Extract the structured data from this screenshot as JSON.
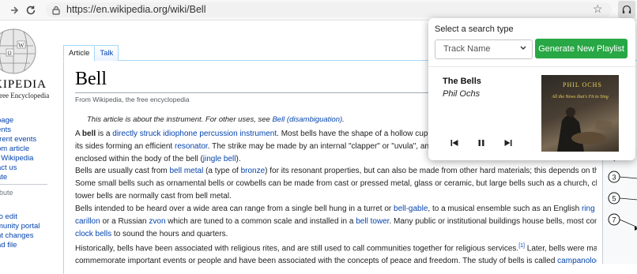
{
  "browser": {
    "url": "https://en.wikipedia.org/wiki/Bell"
  },
  "wiki": {
    "wordmark": "IKIPEDIA",
    "tagline": "Free Encyclopedia",
    "nav": [
      "page",
      "ents",
      "rrent events",
      "om article",
      "t Wikipedia",
      "act us",
      "ate"
    ],
    "nav_heading": "ibute",
    "nav2": [
      "to edit",
      "munity portal",
      "nt changes",
      "ad file"
    ],
    "tabs": {
      "article": "Article",
      "talk": "Talk"
    },
    "title": "Bell",
    "subtitle": "From Wikipedia, the free encyclopedia",
    "hatnote": {
      "text": "This article is about the instrument. For other uses, see ",
      "link": "Bell (disambiguation)",
      "end": "."
    },
    "p1": {
      "l1a": "A ",
      "l1b": "bell",
      "l1c": " is a ",
      "l1d": "directly struck idiophone percussion instrument",
      "l1e": ". Most bells have the shape of a hollow cup that when",
      "l2a": "its sides forming an efficient ",
      "l2b": "resonator",
      "l2c": ". The strike may be made by an internal \"clapper\" or \"uvula\", an external h",
      "l3a": "enclosed within the body of the bell (",
      "l3b": "jingle bell",
      "l3c": ")."
    },
    "p2": {
      "l1a": "Bells are usually cast from ",
      "l1b": "bell metal",
      "l1c": " (a type of ",
      "l1d": "bronze",
      "l1e": ") for its resonant properties, but can also be made from other hard materials; this depends on the function.",
      "l2": "Some small bells such as ornamental bells or cowbells can be made from cast or pressed metal, glass or ceramic, but large bells such as a church, clock and",
      "l3": "tower bells are normally cast from bell metal."
    },
    "p3": {
      "l1a": "Bells intended to be heard over a wide area can range from a single bell hung in a turret or ",
      "l1b": "bell-gable",
      "l1c": ", to a musical ensemble such as an English ",
      "l1d": "ring of bells",
      "l1e": ", a",
      "l2a": "carillon",
      "l2b": " or a Russian ",
      "l2c": "zvon",
      "l2d": " which are tuned to a common scale and installed in a ",
      "l2e": "bell tower",
      "l2f": ". Many public or institutional buildings house bells, most commonly as",
      "l3a": "clock bells",
      "l3b": " to sound the hours and quarters."
    },
    "p4": {
      "l1a": "Historically, bells have been associated with religious rites, and are still used to call communities together for religious services.",
      "l1b": "[1]",
      "l1c": " Later, bells were made to",
      "l2a": "commemorate important events or people and have been associated with the concepts of peace and freedom. The study of bells is called ",
      "l2b": "campanology",
      "l2c": "."
    },
    "diagram_labels": [
      "3",
      "5",
      "7"
    ]
  },
  "popup": {
    "label": "Select a search type",
    "select_value": "Track Name",
    "generate_label": "Generate New Playlist",
    "track_title": "The Bells",
    "track_artist": "Phil Ochs",
    "album_artist": "PHIL OCHS",
    "album_title": "All the News that's Fit to Sing",
    "accent": "#28a745"
  }
}
